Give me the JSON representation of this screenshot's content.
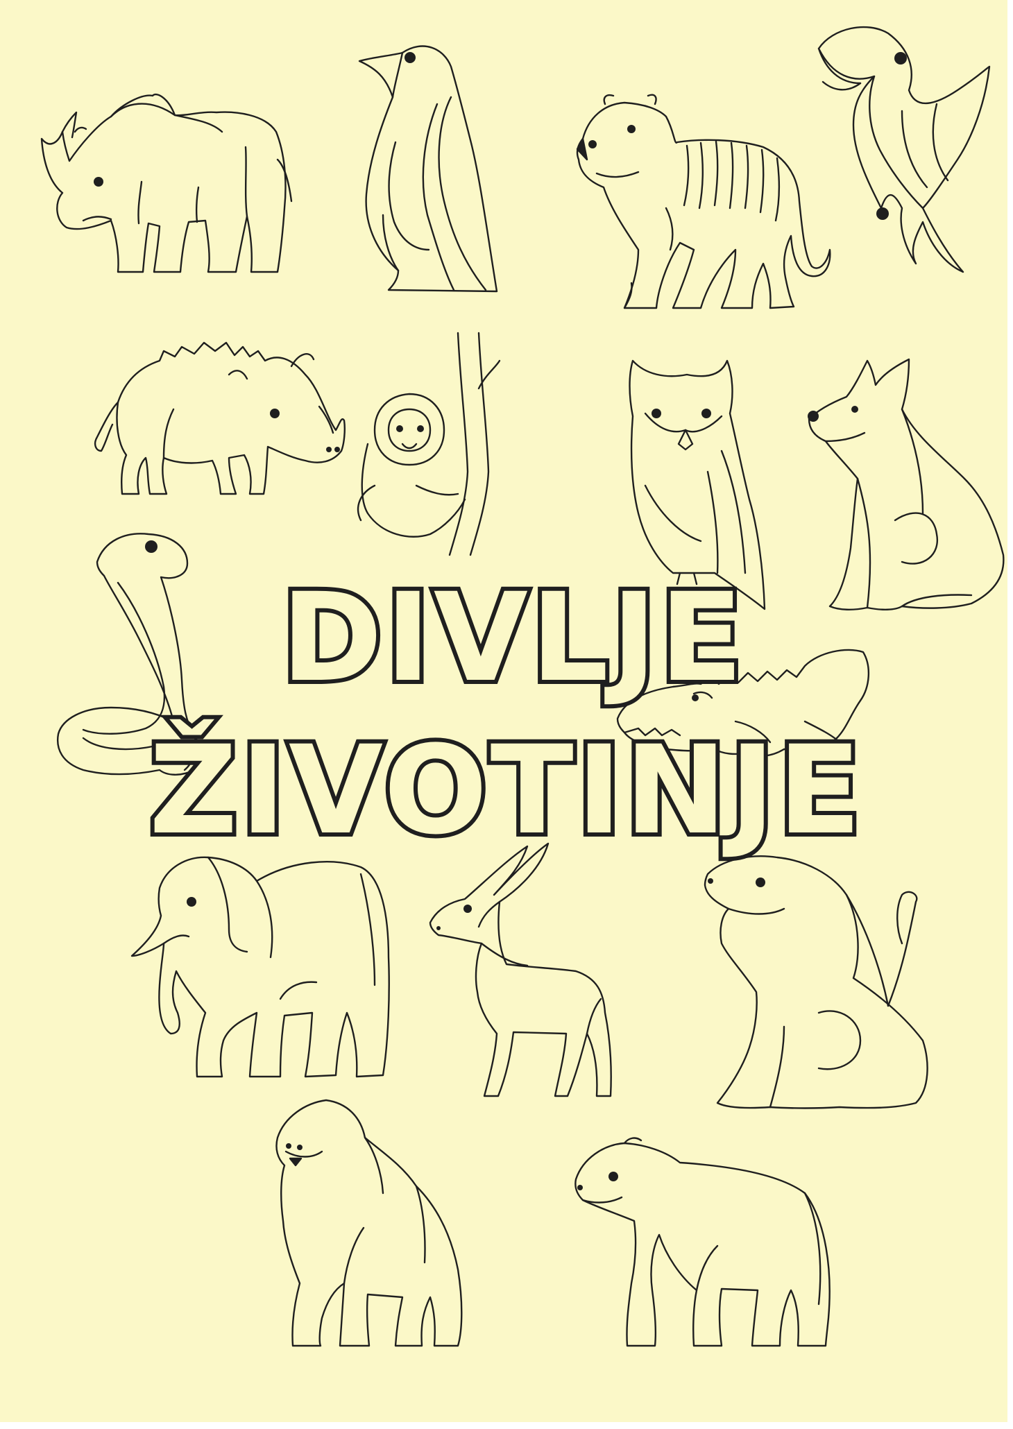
{
  "title": {
    "line1": "DIVLJE",
    "line2": "ŽIVOTINJE"
  },
  "colors": {
    "background": "#fbf8c8",
    "border": "#ffffff",
    "line_art": "#1f1f1f",
    "title_fill": "#fbf8c8",
    "title_outline": "#1f1f1f"
  },
  "illustrations": [
    "rhinoceros",
    "penguin",
    "tiger",
    "parrot",
    "boar",
    "sloth",
    "owl",
    "wolf",
    "cobra",
    "crocodile",
    "elephant",
    "antelope",
    "lion",
    "gorilla",
    "bear"
  ]
}
